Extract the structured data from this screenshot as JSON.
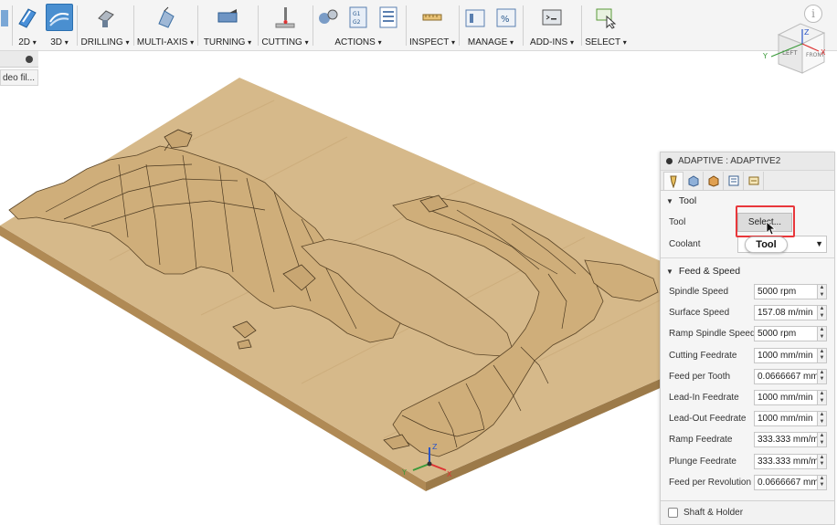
{
  "toolbar": {
    "groups": [
      {
        "id": "2d",
        "label": "2D"
      },
      {
        "id": "3d",
        "label": "3D"
      },
      {
        "id": "drilling",
        "label": "DRILLING"
      },
      {
        "id": "multiaxis",
        "label": "MULTI-AXIS"
      },
      {
        "id": "turning",
        "label": "TURNING"
      },
      {
        "id": "cutting",
        "label": "CUTTING"
      },
      {
        "id": "actions",
        "label": "ACTIONS"
      },
      {
        "id": "inspect",
        "label": "INSPECT"
      },
      {
        "id": "manage",
        "label": "MANAGE"
      },
      {
        "id": "addins",
        "label": "ADD-INS"
      },
      {
        "id": "select",
        "label": "SELECT"
      }
    ],
    "caret": "▾"
  },
  "browser": {
    "file_label": "deo fil..."
  },
  "viewcube": {
    "top": "Z",
    "left": "LEFT",
    "front": "FRONT",
    "axis_x": "X",
    "axis_y": "Y",
    "axis_z": "Z"
  },
  "info": "i",
  "panel": {
    "title": "ADAPTIVE : ADAPTIVE2",
    "tool_section": {
      "heading": "Tool",
      "tool_label": "Tool",
      "select_button": "Select...",
      "coolant_label": "Coolant",
      "tooltip": "Tool"
    },
    "feed_section": {
      "heading": "Feed & Speed",
      "rows": [
        {
          "label": "Spindle Speed",
          "value": "5000 rpm"
        },
        {
          "label": "Surface Speed",
          "value": "157.08 m/min"
        },
        {
          "label": "Ramp Spindle Speed",
          "value": "5000 rpm"
        },
        {
          "label": "Cutting Feedrate",
          "value": "1000 mm/min"
        },
        {
          "label": "Feed per Tooth",
          "value": "0.0666667 mm"
        },
        {
          "label": "Lead-In Feedrate",
          "value": "1000 mm/min"
        },
        {
          "label": "Lead-Out Feedrate",
          "value": "1000 mm/min"
        },
        {
          "label": "Ramp Feedrate",
          "value": "333.333 mm/m"
        },
        {
          "label": "Plunge Feedrate",
          "value": "333.333 mm/m"
        },
        {
          "label": "Feed per Revolution",
          "value": "0.0666667 mm"
        }
      ]
    },
    "shaft_label": "Shaft & Holder"
  },
  "colors": {
    "wood_top": "#d6b98a",
    "wood_side": "#b8955f",
    "highlight": "#e8373b",
    "accent": "#2a6fb0"
  },
  "triad": {
    "x": "X",
    "y": "Y",
    "z": "Z"
  }
}
